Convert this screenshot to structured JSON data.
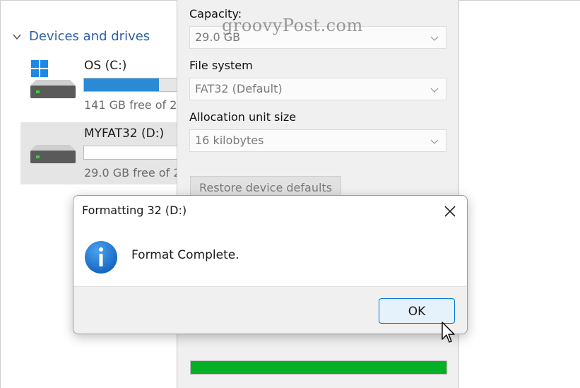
{
  "explorer": {
    "section_header": "Devices and drives",
    "drives": [
      {
        "name": "OS (C:)",
        "free_text": "141 GB free of 2",
        "used_fraction": 0.78,
        "selected": false
      },
      {
        "name": "MYFAT32 (D:)",
        "free_text": "29.0 GB free of 2",
        "used_fraction": 0.0,
        "selected": true
      }
    ]
  },
  "format_panel": {
    "capacity_label": "Capacity:",
    "capacity_value": "29.0 GB",
    "filesystem_label": "File system",
    "filesystem_value": "FAT32 (Default)",
    "allocation_label": "Allocation unit size",
    "allocation_value": "16 kilobytes",
    "restore_label": "Restore device defaults",
    "progress_fraction": 1.0
  },
  "watermark": "groovyPost.com",
  "dialog": {
    "title": "Formatting 32 (D:)",
    "message": "Format Complete.",
    "ok_label": "OK",
    "icon": "info-icon"
  },
  "colors": {
    "accent": "#0078d7",
    "drive_bar": "#2a8ad4",
    "progress": "#06b025",
    "info_icon": "#1e73c8"
  }
}
